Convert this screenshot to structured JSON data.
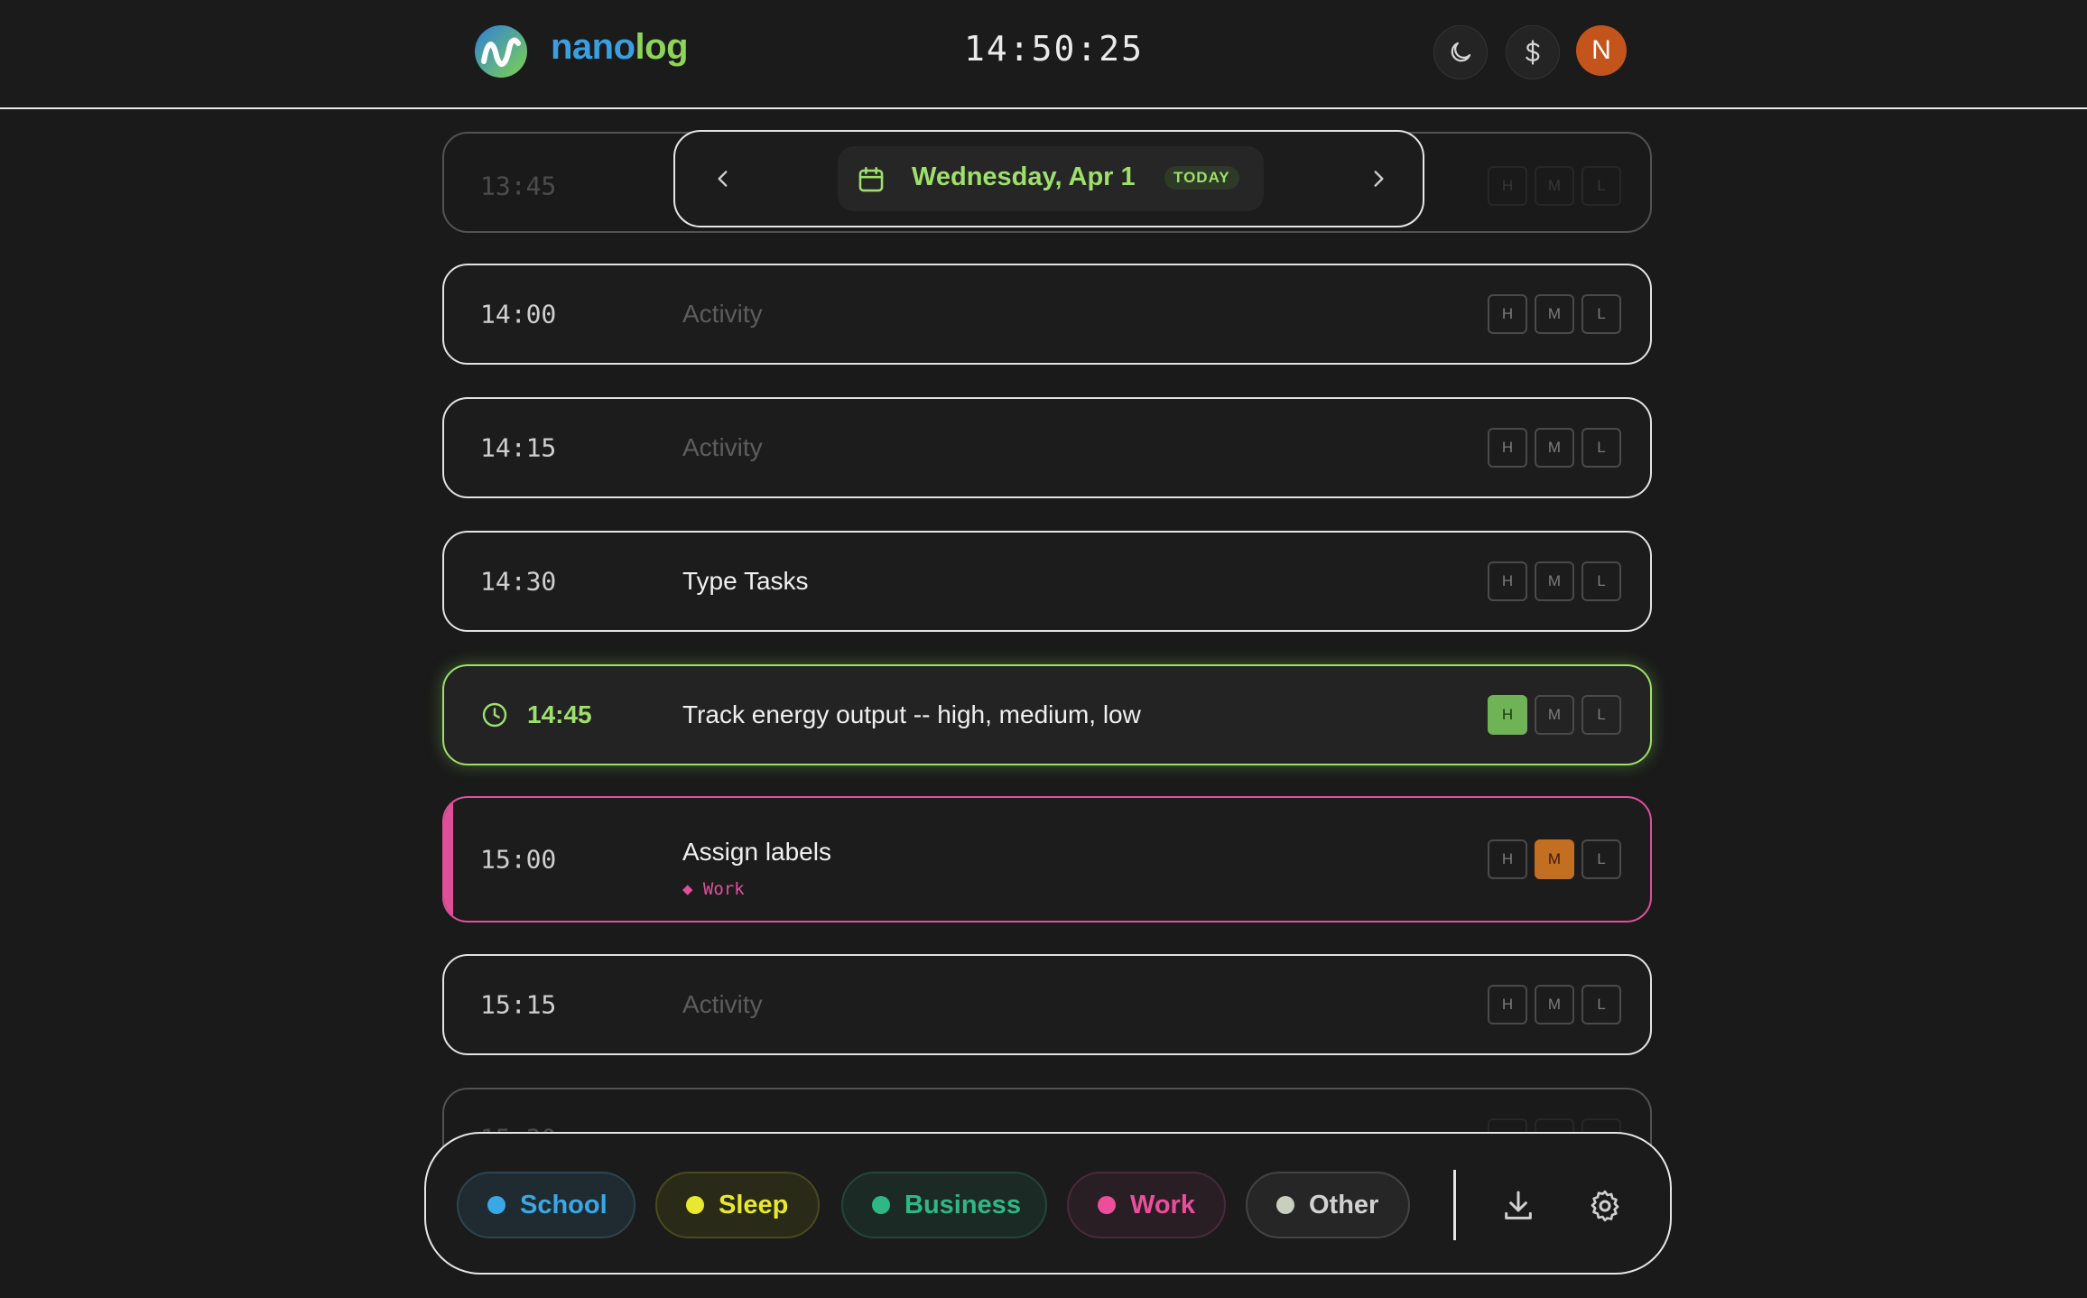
{
  "header": {
    "brand_part1": "nano",
    "brand_part2": "log",
    "clock": "14:50:25",
    "avatar_initial": "N"
  },
  "date_nav": {
    "date_label": "Wednesday, Apr 1",
    "today_badge": "TODAY"
  },
  "level_labels": {
    "high": "H",
    "medium": "M",
    "low": "L"
  },
  "rows": [
    {
      "time": "13:45",
      "activity": "",
      "placeholder": "Activity"
    },
    {
      "time": "14:00",
      "activity": "",
      "placeholder": "Activity"
    },
    {
      "time": "14:15",
      "activity": "",
      "placeholder": "Activity"
    },
    {
      "time": "14:30",
      "activity": "Type Tasks",
      "placeholder": "Activity"
    },
    {
      "time": "14:45",
      "activity": "Track energy output -- high, medium, low",
      "placeholder": "Activity",
      "current": true,
      "energy": "H"
    },
    {
      "time": "15:00",
      "activity": "Assign labels",
      "placeholder": "Activity",
      "label": "Work",
      "energy": "M"
    },
    {
      "time": "15:15",
      "activity": "",
      "placeholder": "Activity"
    },
    {
      "time": "15:30",
      "activity": "",
      "placeholder": "Activity"
    }
  ],
  "categories": [
    {
      "name": "School",
      "color": "#3aa8e6"
    },
    {
      "name": "Sleep",
      "color": "#e8e830"
    },
    {
      "name": "Business",
      "color": "#2fb886"
    },
    {
      "name": "Work",
      "color": "#ec4e9c"
    },
    {
      "name": "Other",
      "color": "#c9cfbf"
    }
  ],
  "colors": {
    "accent": "#9ee06a",
    "work": "#e0509a",
    "high": "#6fb356",
    "medium": "#c26f22"
  }
}
